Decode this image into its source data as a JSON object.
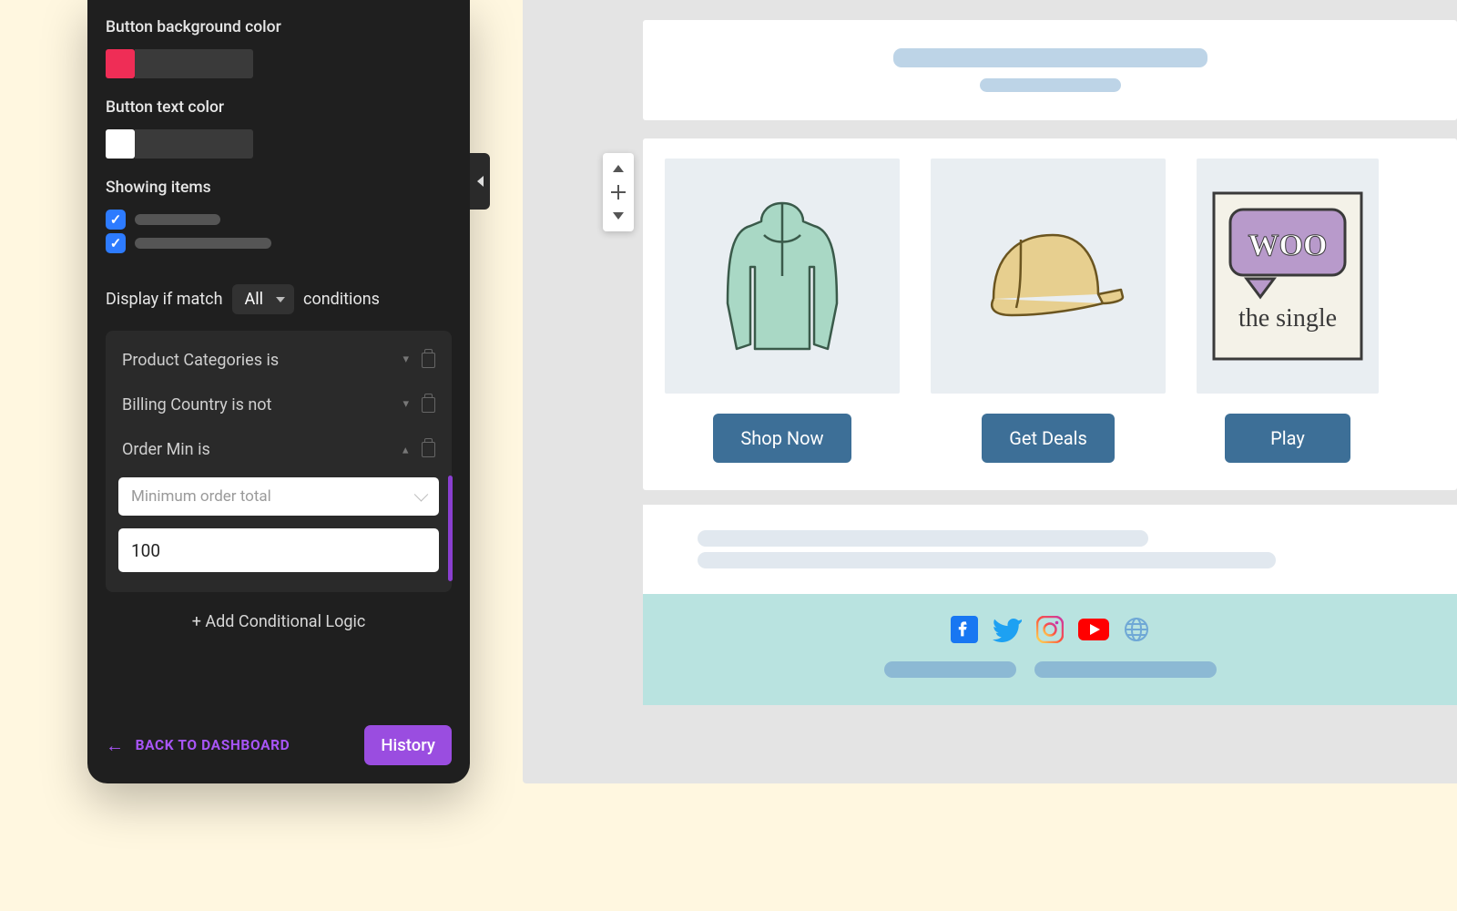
{
  "sidebar": {
    "bg_color_label": "Button background color",
    "bg_color": "#ef2d56",
    "text_color_label": "Button text color",
    "text_color": "#ffffff",
    "showing_label": "Showing items",
    "display_prefix": "Display if match",
    "match_mode": "All",
    "display_suffix": "conditions",
    "conditions": [
      {
        "label": "Product Categories is",
        "open": false
      },
      {
        "label": "Billing Country is not",
        "open": false
      },
      {
        "label": "Order Min is",
        "open": true,
        "placeholder": "Minimum order total",
        "value": "100"
      }
    ],
    "add_logic": "+ Add Conditional Logic",
    "back_label": "BACK TO DASHBOARD",
    "history_label": "History"
  },
  "preview": {
    "products": [
      {
        "button": "Shop Now",
        "art": "hoodie"
      },
      {
        "button": "Get Deals",
        "art": "cap"
      },
      {
        "button": "Play",
        "art": "woo"
      }
    ]
  }
}
